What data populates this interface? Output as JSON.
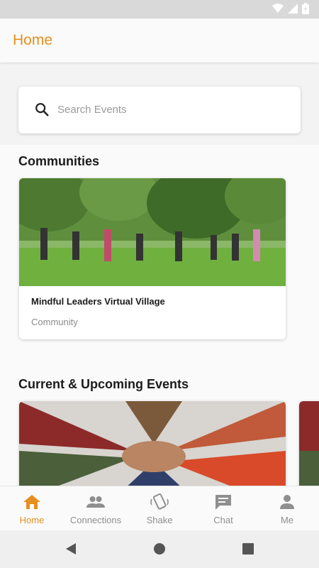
{
  "app": {
    "title": "Home",
    "accent": "#E58F1F"
  },
  "search": {
    "placeholder": "Search Events"
  },
  "communities": {
    "title": "Communities",
    "cards": [
      {
        "name": "Mindful Leaders Virtual Village",
        "type": "Community"
      }
    ]
  },
  "events": {
    "title": "Current & Upcoming Events"
  },
  "bottom_nav": {
    "items": [
      {
        "label": "Home",
        "icon": "home-icon",
        "active": true
      },
      {
        "label": "Connections",
        "icon": "people-icon"
      },
      {
        "label": "Shake",
        "icon": "shake-phone-icon"
      },
      {
        "label": "Chat",
        "icon": "chat-icon"
      },
      {
        "label": "Me",
        "icon": "person-icon"
      }
    ]
  },
  "system_nav": {
    "icons": [
      "back-icon",
      "home-circle-icon",
      "recents-icon"
    ]
  }
}
